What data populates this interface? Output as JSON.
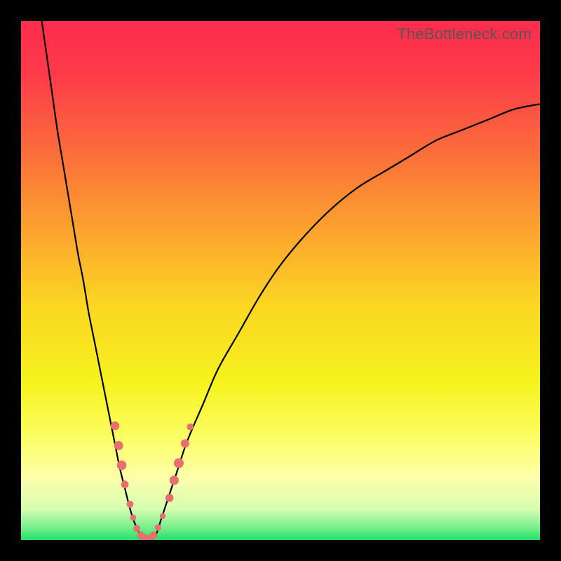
{
  "watermark": "TheBottleneck.com",
  "chart_data": {
    "type": "line",
    "title": "",
    "xlabel": "",
    "ylabel": "",
    "xlim": [
      0,
      100
    ],
    "ylim": [
      0,
      100
    ],
    "gradient_stops": [
      {
        "offset": 0,
        "color": "#fd2c4d"
      },
      {
        "offset": 0.1,
        "color": "#fd3a4a"
      },
      {
        "offset": 0.25,
        "color": "#fb6c3a"
      },
      {
        "offset": 0.4,
        "color": "#fca22f"
      },
      {
        "offset": 0.55,
        "color": "#fbd722"
      },
      {
        "offset": 0.7,
        "color": "#f6f31e"
      },
      {
        "offset": 0.8,
        "color": "#fbfe62"
      },
      {
        "offset": 0.88,
        "color": "#fdffaa"
      },
      {
        "offset": 0.94,
        "color": "#d6fdb0"
      },
      {
        "offset": 0.975,
        "color": "#7cf08e"
      },
      {
        "offset": 1.0,
        "color": "#22e169"
      }
    ],
    "series": [
      {
        "name": "bottleneck-curve",
        "x": [
          4,
          5,
          6,
          7,
          8,
          9,
          10,
          11,
          12,
          13,
          14,
          15,
          16,
          17,
          18,
          19,
          20,
          21,
          22,
          23,
          24,
          25,
          26,
          27,
          28,
          30,
          32,
          35,
          38,
          42,
          46,
          50,
          55,
          60,
          65,
          70,
          75,
          80,
          85,
          90,
          95,
          100
        ],
        "y": [
          100,
          93,
          86,
          79,
          73,
          67,
          61,
          55,
          50,
          44,
          39,
          34,
          29,
          24,
          19,
          14,
          10,
          6,
          3,
          1,
          0,
          0,
          1,
          4,
          7,
          13,
          19,
          26,
          33,
          40,
          47,
          53,
          59,
          64,
          68,
          71,
          74,
          77,
          79,
          81,
          83,
          84
        ]
      }
    ],
    "markers": [
      {
        "x": 18.1,
        "y": 22.0,
        "r": 6.2
      },
      {
        "x": 18.8,
        "y": 18.2,
        "r": 6.5
      },
      {
        "x": 19.4,
        "y": 14.4,
        "r": 6.8
      },
      {
        "x": 20.0,
        "y": 10.7,
        "r": 5.4
      },
      {
        "x": 21.0,
        "y": 6.9,
        "r": 5.0
      },
      {
        "x": 21.6,
        "y": 4.3,
        "r": 4.4
      },
      {
        "x": 22.3,
        "y": 2.2,
        "r": 5.0
      },
      {
        "x": 23.1,
        "y": 0.9,
        "r": 5.5
      },
      {
        "x": 23.9,
        "y": 0.3,
        "r": 5.8
      },
      {
        "x": 24.7,
        "y": 0.2,
        "r": 6.0
      },
      {
        "x": 25.5,
        "y": 0.9,
        "r": 5.5
      },
      {
        "x": 26.4,
        "y": 2.4,
        "r": 4.6
      },
      {
        "x": 27.3,
        "y": 4.6,
        "r": 4.2
      },
      {
        "x": 28.6,
        "y": 8.1,
        "r": 5.8
      },
      {
        "x": 29.5,
        "y": 11.5,
        "r": 6.6
      },
      {
        "x": 30.4,
        "y": 14.8,
        "r": 7.0
      },
      {
        "x": 31.6,
        "y": 18.6,
        "r": 6.0
      },
      {
        "x": 32.6,
        "y": 21.8,
        "r": 4.8
      }
    ]
  }
}
